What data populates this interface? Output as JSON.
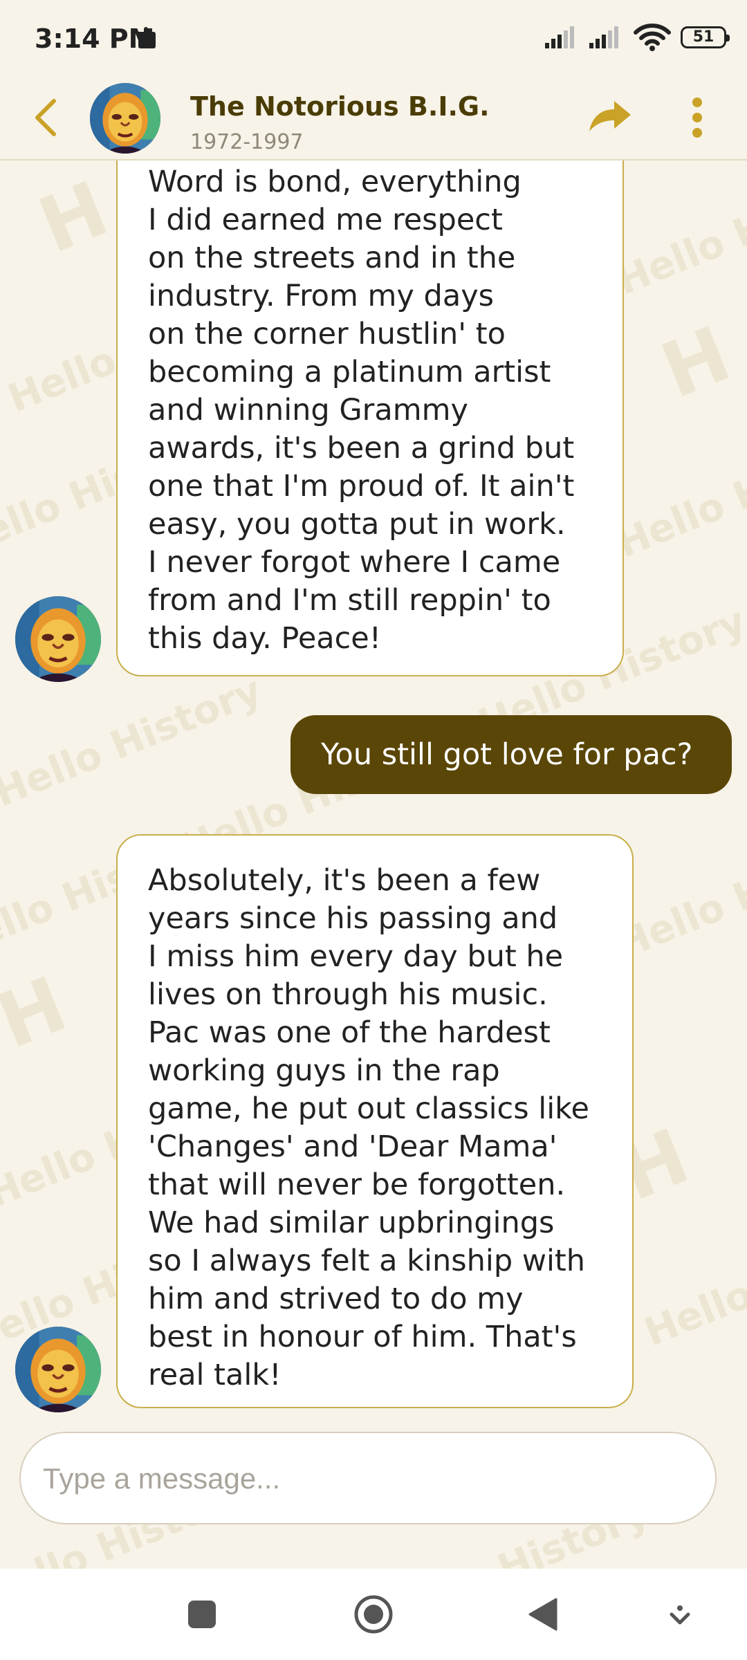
{
  "status_bar": {
    "time": "3:14 PM",
    "battery": "51",
    "icons": [
      "app-notification-icon",
      "signal-icon",
      "signal-icon",
      "wifi-icon",
      "battery-icon"
    ]
  },
  "header": {
    "title": "The Notorious B.I.G.",
    "subtitle": "1972-1997",
    "icons": [
      "back-arrow-icon",
      "share-arrow-icon",
      "more-vertical-icon"
    ],
    "accent_color": "#c9a227"
  },
  "watermark": {
    "text": "Hello History",
    "letter": "H"
  },
  "messages": [
    {
      "sender": "assistant",
      "text": "Word is bond, everything\nI did earned me respect\non the streets and in the\nindustry. From my days\non the corner hustlin' to\nbecoming a platinum artist\nand winning Grammy\nawards, it's been a grind but\none that I'm proud of. It ain't\neasy, you gotta put in work.\nI never forgot where I came\nfrom and I'm still reppin' to\nthis day. Peace!"
    },
    {
      "sender": "user",
      "text": "You still got love for pac?"
    },
    {
      "sender": "assistant",
      "text": "Absolutely, it's been a few\nyears since his passing and\nI miss him every day but he\nlives on through his music.\nPac was one of the hardest\nworking guys in the rap\ngame, he put out classics like\n'Changes' and 'Dear Mama'\nthat will never be forgotten.\nWe had similar upbringings\nso I always felt a kinship with\nhim and strived to do my\nbest in honour of him. That's\nreal talk!"
    }
  ],
  "composer": {
    "placeholder": "Type a message...",
    "value": ""
  },
  "colors": {
    "user_bubble": "#5a4606",
    "assistant_border": "#c9ae4a",
    "background": "#f7f3e8"
  },
  "nav_bar": {
    "icons": [
      "recents-square-icon",
      "home-circle-icon",
      "back-triangle-icon",
      "hide-nav-icon"
    ]
  }
}
